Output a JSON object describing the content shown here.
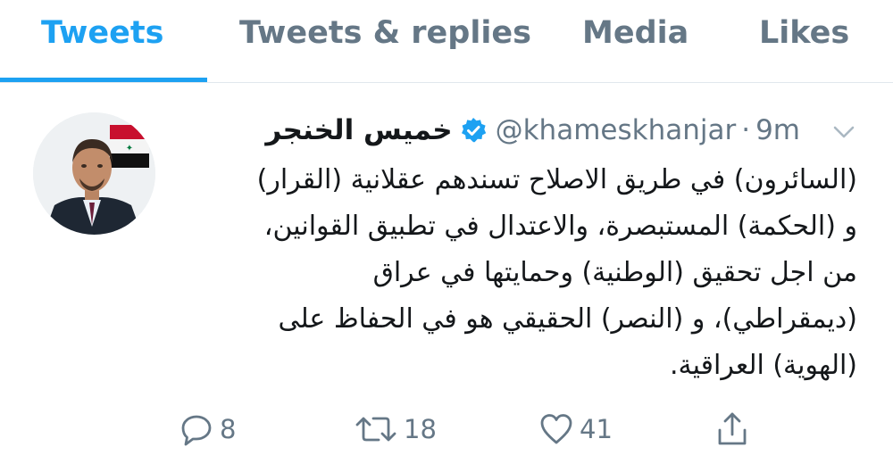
{
  "tabs": [
    {
      "label": "Tweets",
      "active": true
    },
    {
      "label": "Tweets & replies",
      "active": false
    },
    {
      "label": "Media",
      "active": false
    },
    {
      "label": "Likes",
      "active": false
    }
  ],
  "tweet": {
    "display_name": "خميس الخنجر",
    "verified": true,
    "handle": "@khameskhanjar",
    "separator": "·",
    "time": "9m",
    "text_lines": [
      "(السائرون) في طريق الاصلاح تسندهم عقلانية (القرار)",
      "و (الحكمة) المستبصرة، والاعتدال في تطبيق القوانين،",
      "من اجل تحقيق (الوطنية) وحمايتها في عراق",
      "(ديمقراطي)،  و (النصر) الحقيقي هو في الحفاظ على",
      "(الهوية) العراقية."
    ],
    "actions": {
      "reply_count": "8",
      "retweet_count": "18",
      "like_count": "41"
    }
  },
  "icons": {
    "verified": "verified-badge-icon",
    "chevron": "chevron-down-icon",
    "reply": "reply-icon",
    "retweet": "retweet-icon",
    "like": "heart-icon",
    "share": "share-icon"
  },
  "colors": {
    "accent": "#1da1f2",
    "muted": "#657786",
    "text": "#14171a"
  }
}
